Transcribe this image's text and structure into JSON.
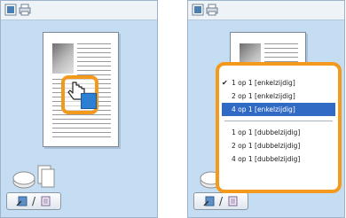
{
  "left_panel": {
    "icons": [
      "page-view-icon",
      "printer-icon"
    ]
  },
  "right_panel": {
    "menu": {
      "group1": [
        {
          "label": "1 op 1 [enkelzijdig]",
          "checked": true,
          "selected": false
        },
        {
          "label": "2 op 1 [enkelzijdig]",
          "checked": false,
          "selected": false
        },
        {
          "label": "4 op 1 [enkelzijdig]",
          "checked": false,
          "selected": true
        }
      ],
      "group2": [
        {
          "label": "1 op 1 [dubbelzijdig]",
          "checked": false,
          "selected": false
        },
        {
          "label": "2 op 1 [dubbelzijdig]",
          "checked": false,
          "selected": false
        },
        {
          "label": "4 op 1 [dubbelzijdig]",
          "checked": false,
          "selected": false
        }
      ]
    }
  },
  "bottom_bar": {
    "separator": "/"
  },
  "colors": {
    "panel_bg": "#c5ddf3",
    "highlight": "#f39a1d",
    "selection": "#316ac5"
  }
}
